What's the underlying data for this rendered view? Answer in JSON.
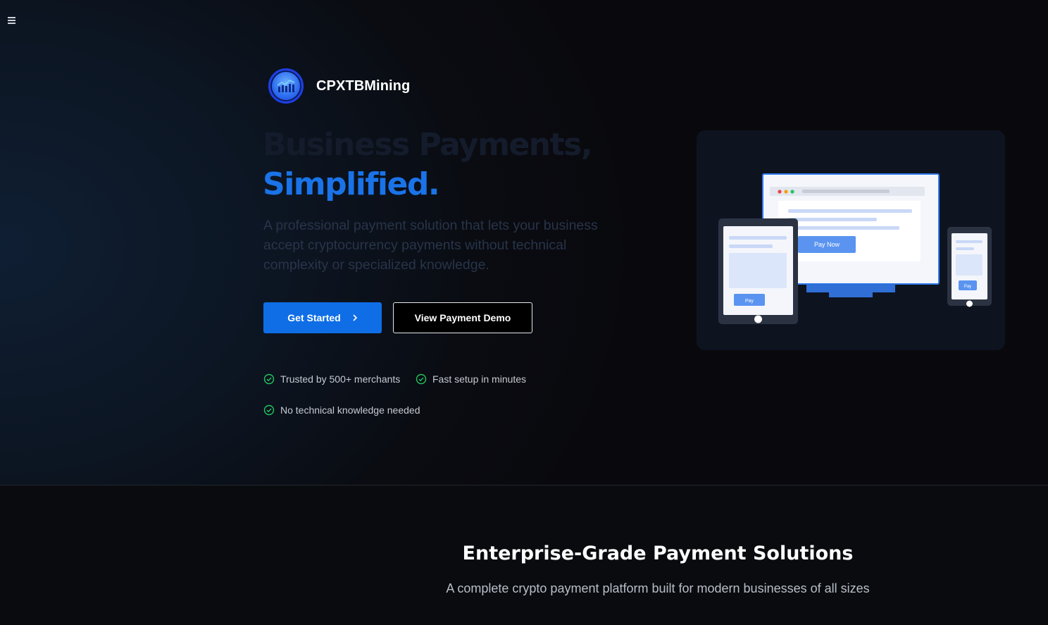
{
  "nav": {
    "menu_icon": "hamburger-menu-icon"
  },
  "brand": {
    "name": "CPXTBMining",
    "logo_icon": "chart-bars-coin-icon"
  },
  "hero": {
    "headline_line1": "Business Payments,",
    "headline_line2": "Simplified.",
    "subtitle": "A professional payment solution that lets your business accept cryptocurrency payments without technical complexity or specialized knowledge.",
    "primary_button": "Get Started",
    "secondary_button": "View Payment Demo",
    "features": [
      "Trusted by 500+ merchants",
      "Fast setup in minutes",
      "No technical knowledge needed"
    ]
  },
  "illustration": {
    "desktop_button": "Pay Now",
    "tablet_button": "Pay",
    "phone_button": "Pay"
  },
  "section": {
    "title": "Enterprise-Grade Payment Solutions",
    "subtitle": "A complete crypto payment platform built for modern businesses of all sizes"
  },
  "colors": {
    "accent": "#0f6ee6",
    "headline_accent": "#1a73e8",
    "check": "#22c55e",
    "background": "#0a0b0f"
  }
}
